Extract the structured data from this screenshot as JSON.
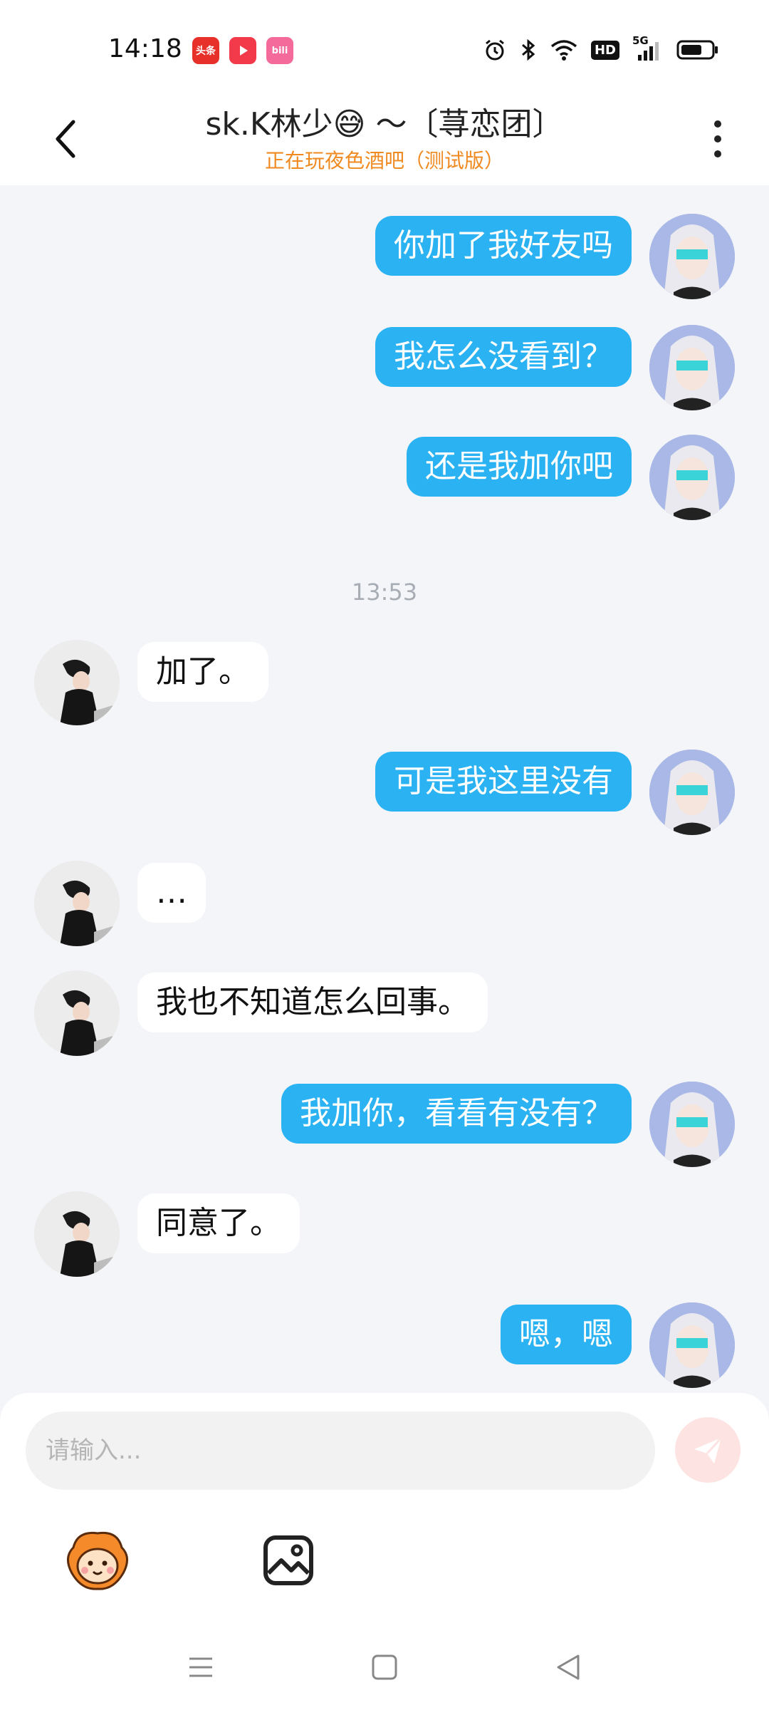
{
  "status_bar": {
    "time": "14:18",
    "app_icons": [
      {
        "name": "toutiao-icon",
        "label": "头条",
        "color": "#e8302b"
      },
      {
        "name": "video-icon",
        "label": "",
        "color": "#f23a4a"
      },
      {
        "name": "bilibili-icon",
        "label": "bili",
        "color": "#f46b9b"
      }
    ],
    "hd_label": "HD",
    "network_label": "5G",
    "battery_level": 0.7
  },
  "header": {
    "title": "sk.K林少😅 ～〔荨恋团〕",
    "subtitle": "正在玩夜色酒吧（测试版）"
  },
  "messages": [
    {
      "type": "me",
      "text": "你加了我好友吗"
    },
    {
      "type": "me",
      "text": "我怎么没看到？"
    },
    {
      "type": "me",
      "text": "还是我加你吧"
    },
    {
      "type": "time",
      "text": "13:53"
    },
    {
      "type": "peer",
      "text": "加了。"
    },
    {
      "type": "me",
      "text": "可是我这里没有"
    },
    {
      "type": "peer",
      "text": "…"
    },
    {
      "type": "peer",
      "text": "我也不知道怎么回事。"
    },
    {
      "type": "me",
      "text": "我加你，看看有没有？"
    },
    {
      "type": "peer",
      "text": "同意了。"
    },
    {
      "type": "me",
      "text": "嗯，嗯"
    }
  ],
  "composer": {
    "placeholder": "请输入...",
    "send_icon": "send-icon",
    "tools": [
      "sticker-icon",
      "image-icon"
    ]
  },
  "colors": {
    "my_bubble": "#2ab2f2",
    "peer_bubble": "#ffffff",
    "subtitle": "#ef8a21",
    "send_button": "#fde3e2"
  }
}
